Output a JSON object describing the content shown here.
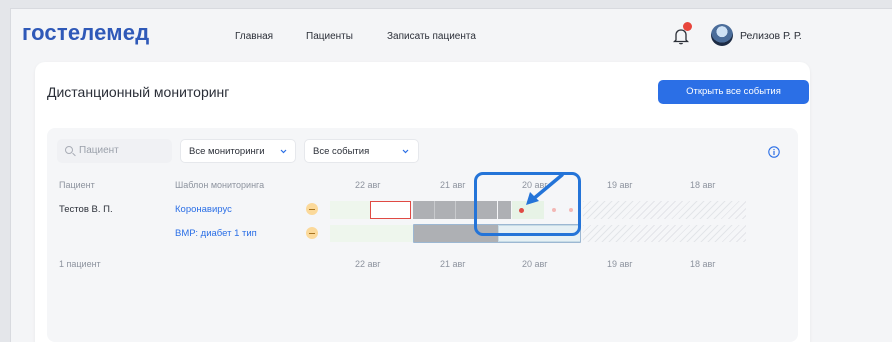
{
  "header": {
    "logo": "гостелемед",
    "nav": [
      "Главная",
      "Пациенты",
      "Записать пациента"
    ],
    "user_name": "Релизов Р. Р.",
    "notification_color": "#e8453c"
  },
  "card": {
    "title": "Дистанционный мониторинг",
    "open_all_button": "Открыть все события"
  },
  "filters": {
    "search_placeholder": "Пациент",
    "monitoring_select": "Все мониторинги",
    "events_select": "Все события"
  },
  "table": {
    "col_patient": "Пациент",
    "col_template": "Шаблон мониторинга",
    "dates": [
      "22 авг",
      "21 авг",
      "20 авг",
      "19 авг",
      "18 авг"
    ],
    "rows": [
      {
        "patient": "Тестов В. П.",
        "template": "Коронавирус"
      },
      {
        "patient": "",
        "template": "ВМР: диабет 1 тип"
      }
    ],
    "footer_count": "1 пациент"
  },
  "colors": {
    "accent": "#2b6fe6",
    "logo": "#2f59b8",
    "timeline_gray": "#aeb0b4",
    "timeline_green": "#e7f3e6",
    "event_red": "#e04a44",
    "highlight": "#2474d8"
  }
}
